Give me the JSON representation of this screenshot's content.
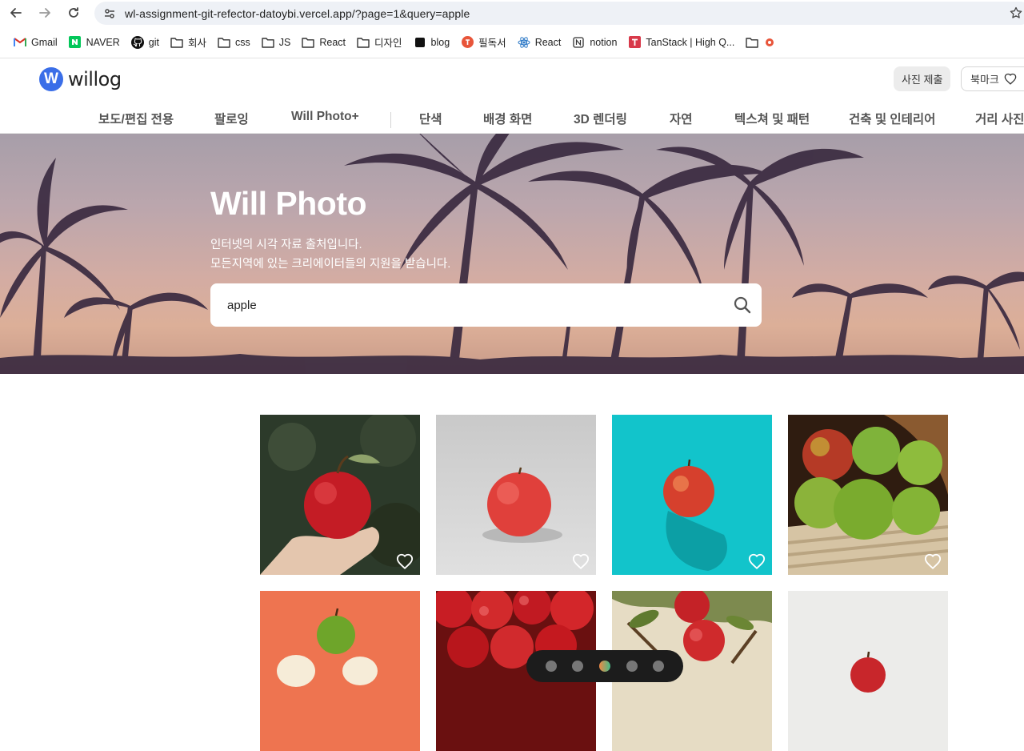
{
  "browser": {
    "url": "wl-assignment-git-refector-datoybi.vercel.app/?page=1&query=apple",
    "bookmarks": [
      {
        "label": "Gmail",
        "icon": "gmail-icon"
      },
      {
        "label": "NAVER",
        "icon": "naver-icon"
      },
      {
        "label": "git",
        "icon": "github-icon"
      },
      {
        "label": "회사",
        "icon": "folder-icon"
      },
      {
        "label": "css",
        "icon": "folder-icon"
      },
      {
        "label": "JS",
        "icon": "folder-icon"
      },
      {
        "label": "React",
        "icon": "folder-icon"
      },
      {
        "label": "디자인",
        "icon": "folder-icon"
      },
      {
        "label": "blog",
        "icon": "blog-icon"
      },
      {
        "label": "필독서",
        "icon": "book-icon"
      },
      {
        "label": "React",
        "icon": "react-icon"
      },
      {
        "label": "notion",
        "icon": "notion-icon"
      },
      {
        "label": "TanStack | High Q...",
        "icon": "tanstack-icon"
      },
      {
        "label": "",
        "icon": "folder-icon"
      }
    ]
  },
  "header": {
    "logo_letter": "W",
    "logo_text": "willog",
    "submit_label": "사진 제출",
    "bookmark_label": "북마크",
    "categories": [
      "보도/편집 전용",
      "팔로잉",
      "Will Photo+",
      "단색",
      "배경 화면",
      "3D 렌더링",
      "자연",
      "텍스쳐 및 패턴",
      "건축 및 인테리어",
      "거리 사진"
    ]
  },
  "hero": {
    "title": "Will Photo",
    "desc_line1": "인터넷의 시각 자료 출처입니다.",
    "desc_line2": "모든지역에 있는 크리에이터들의 지원을 받습니다.",
    "search_value": "apple"
  },
  "photos": [
    {
      "alt": "hand holding red apple",
      "bg": "#2e3a2c"
    },
    {
      "alt": "red apple on grey",
      "bg": "#cfcfcf"
    },
    {
      "alt": "red apple on cyan",
      "bg": "#12c6cc"
    },
    {
      "alt": "green apples on burlap",
      "bg": "#3a2416"
    },
    {
      "alt": "green apple on orange",
      "bg": "#ee7450"
    },
    {
      "alt": "pile of red apples",
      "bg": "#7c1414"
    },
    {
      "alt": "apples on tree",
      "bg": "#e6ddc7"
    },
    {
      "alt": "apple on light background",
      "bg": "#ececec"
    }
  ],
  "colors": {
    "accent": "#3a6ee8",
    "hero_text": "#ffffff"
  }
}
